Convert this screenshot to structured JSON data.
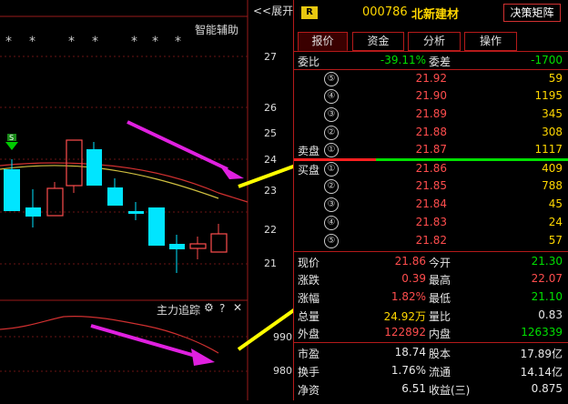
{
  "header": {
    "back_label": "<<展开",
    "r_badge": "R",
    "stock_code": "000786",
    "stock_name": "北新建材",
    "matrix_button": "决策矩阵"
  },
  "chart": {
    "assist_label": "智能辅助",
    "stars": [
      "*",
      "*",
      "*",
      "*",
      "*",
      "*",
      "*"
    ],
    "price_axis": [
      "27",
      "26",
      "25",
      "24",
      "23",
      "22",
      "21"
    ],
    "indicator_label": "主力追踪",
    "indicator_axis": [
      "990",
      "980"
    ],
    "signal_label": "S"
  },
  "tabs": [
    "报价",
    "资金",
    "分析",
    "操作"
  ],
  "quote": {
    "weibi_label": "委比",
    "weibi_value": "-39.11%",
    "weicha_label": "委差",
    "weicha_value": "-1700",
    "sell_label": "卖盘",
    "buy_label": "买盘",
    "sell_orders": [
      {
        "level": "⑤",
        "price": "21.92",
        "volume": "59"
      },
      {
        "level": "④",
        "price": "21.90",
        "volume": "1195"
      },
      {
        "level": "③",
        "price": "21.89",
        "volume": "345"
      },
      {
        "level": "②",
        "price": "21.88",
        "volume": "308"
      },
      {
        "level": "①",
        "price": "21.87",
        "volume": "1117"
      }
    ],
    "buy_orders": [
      {
        "level": "①",
        "price": "21.86",
        "volume": "409"
      },
      {
        "level": "②",
        "price": "21.85",
        "volume": "788"
      },
      {
        "level": "③",
        "price": "21.84",
        "volume": "45"
      },
      {
        "level": "④",
        "price": "21.83",
        "volume": "24"
      },
      {
        "level": "⑤",
        "price": "21.82",
        "volume": "57"
      }
    ]
  },
  "stats": {
    "xianjia_label": "现价",
    "xianjia": "21.86",
    "jinkai_label": "今开",
    "jinkai": "21.30",
    "zhangdie_label": "涨跌",
    "zhangdie": "0.39",
    "zuigao_label": "最高",
    "zuigao": "22.07",
    "zhangfu_label": "涨幅",
    "zhangfu": "1.82%",
    "zuidi_label": "最低",
    "zuidi": "21.10",
    "zongliang_label": "总量",
    "zongliang": "24.92万",
    "liangbi_label": "量比",
    "liangbi": "0.83",
    "waipan_label": "外盘",
    "waipan": "122892",
    "neipan_label": "内盘",
    "neipan": "126339",
    "shiying_label": "市盈",
    "shiying": "18.74",
    "guben_label": "股本",
    "guben": "17.89亿",
    "huanshou_label": "换手",
    "huanshou": "1.76%",
    "liutong_label": "流通",
    "liutong": "14.14亿",
    "jingzi_label": "净资",
    "jingzi": "6.51",
    "shouyi_label": "收益(三)",
    "shouyi": "0.875"
  },
  "colors": {
    "up": "#ff4d4d",
    "down": "#00e000",
    "cyan_candle": "#00e5ff",
    "arrow_magenta": "#e020e0",
    "arrow_yellow": "#ffff00",
    "border": "#b51a1a"
  }
}
